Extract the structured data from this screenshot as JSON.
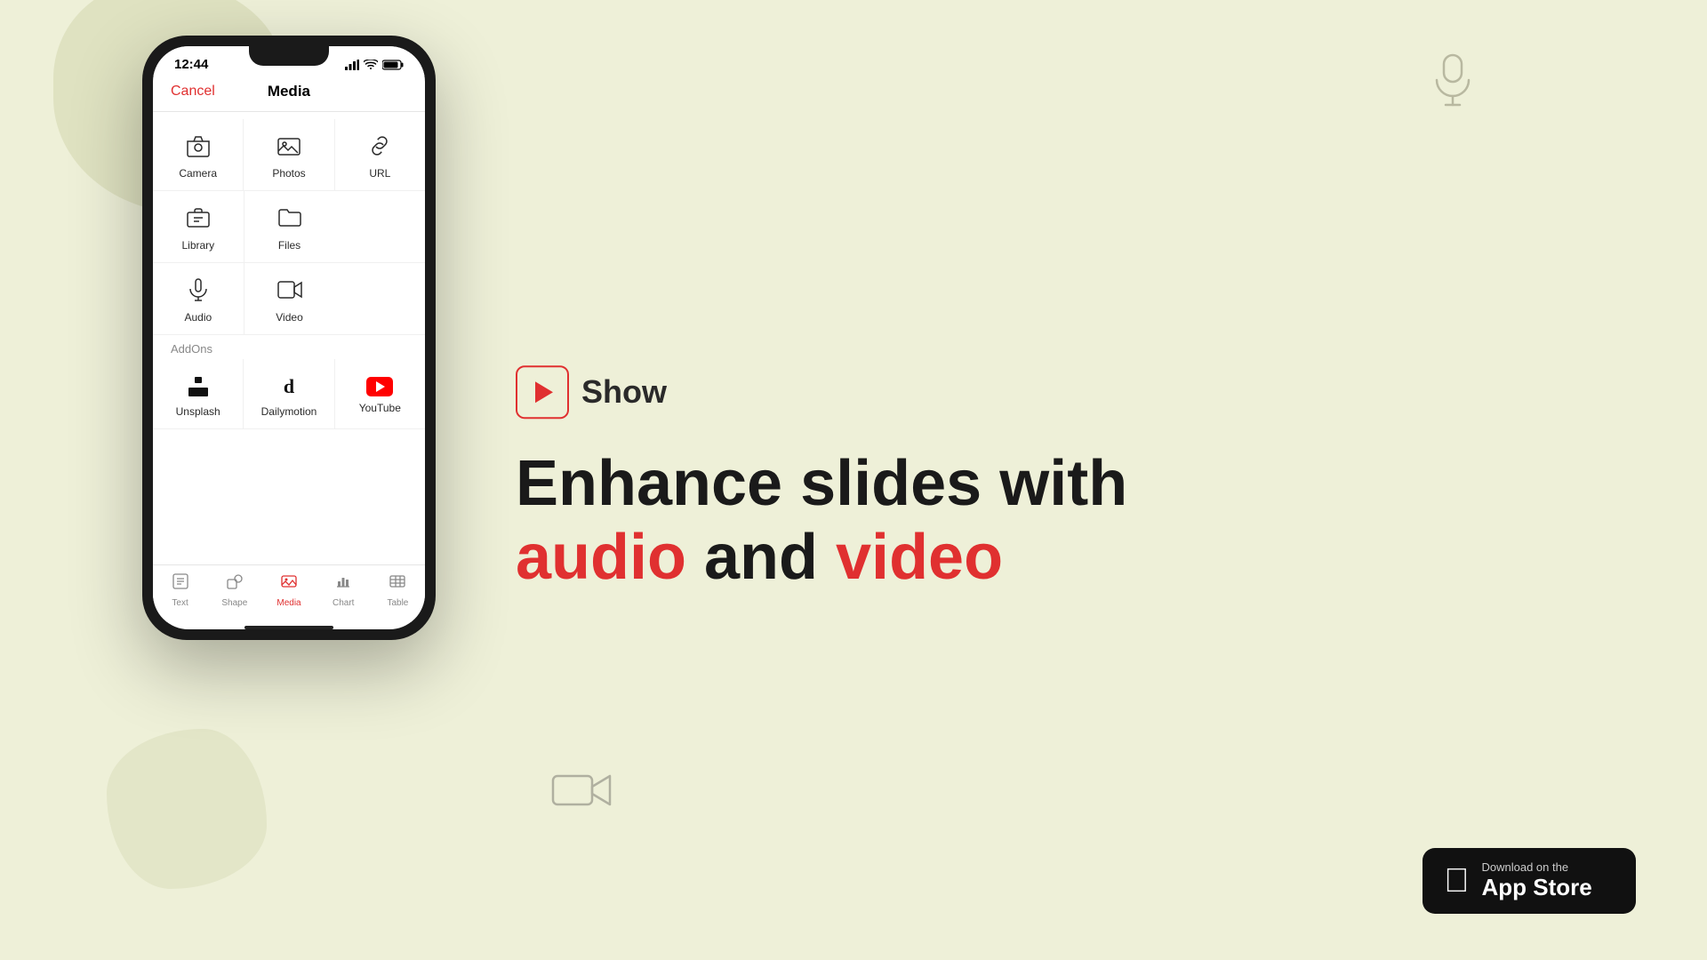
{
  "background_color": "#eef0d8",
  "phone": {
    "status_bar": {
      "time": "12:44",
      "signal_icon": "signal-icon",
      "wifi_icon": "wifi-icon",
      "battery_icon": "battery-icon"
    },
    "header": {
      "cancel_label": "Cancel",
      "title": "Media"
    },
    "media_items": [
      {
        "id": "camera",
        "label": "Camera",
        "icon": "camera"
      },
      {
        "id": "photos",
        "label": "Photos",
        "icon": "photos"
      },
      {
        "id": "url",
        "label": "URL",
        "icon": "url"
      },
      {
        "id": "library",
        "label": "Library",
        "icon": "library"
      },
      {
        "id": "files",
        "label": "Files",
        "icon": "files"
      },
      {
        "id": "audio",
        "label": "Audio",
        "icon": "audio"
      },
      {
        "id": "video",
        "label": "Video",
        "icon": "video"
      }
    ],
    "addons_label": "AddOns",
    "addons": [
      {
        "id": "unsplash",
        "label": "Unsplash",
        "icon": "unsplash"
      },
      {
        "id": "dailymotion",
        "label": "Dailymotion",
        "icon": "dailymotion"
      },
      {
        "id": "youtube",
        "label": "YouTube",
        "icon": "youtube"
      }
    ],
    "tabs": [
      {
        "id": "text",
        "label": "Text",
        "active": false
      },
      {
        "id": "shape",
        "label": "Shape",
        "active": false
      },
      {
        "id": "media",
        "label": "Media",
        "active": true
      },
      {
        "id": "chart",
        "label": "Chart",
        "active": false
      },
      {
        "id": "table",
        "label": "Table",
        "active": false
      }
    ]
  },
  "right_panel": {
    "show_label": "Show",
    "headline_part1": "Enhance slides with",
    "headline_part2": "audio",
    "headline_part3": " and ",
    "headline_part4": "video"
  },
  "app_store": {
    "small_text": "Download on the",
    "big_text": "App Store"
  },
  "decorative": {
    "mic_label": "microphone-icon",
    "video_cam_label": "video-camera-icon"
  }
}
